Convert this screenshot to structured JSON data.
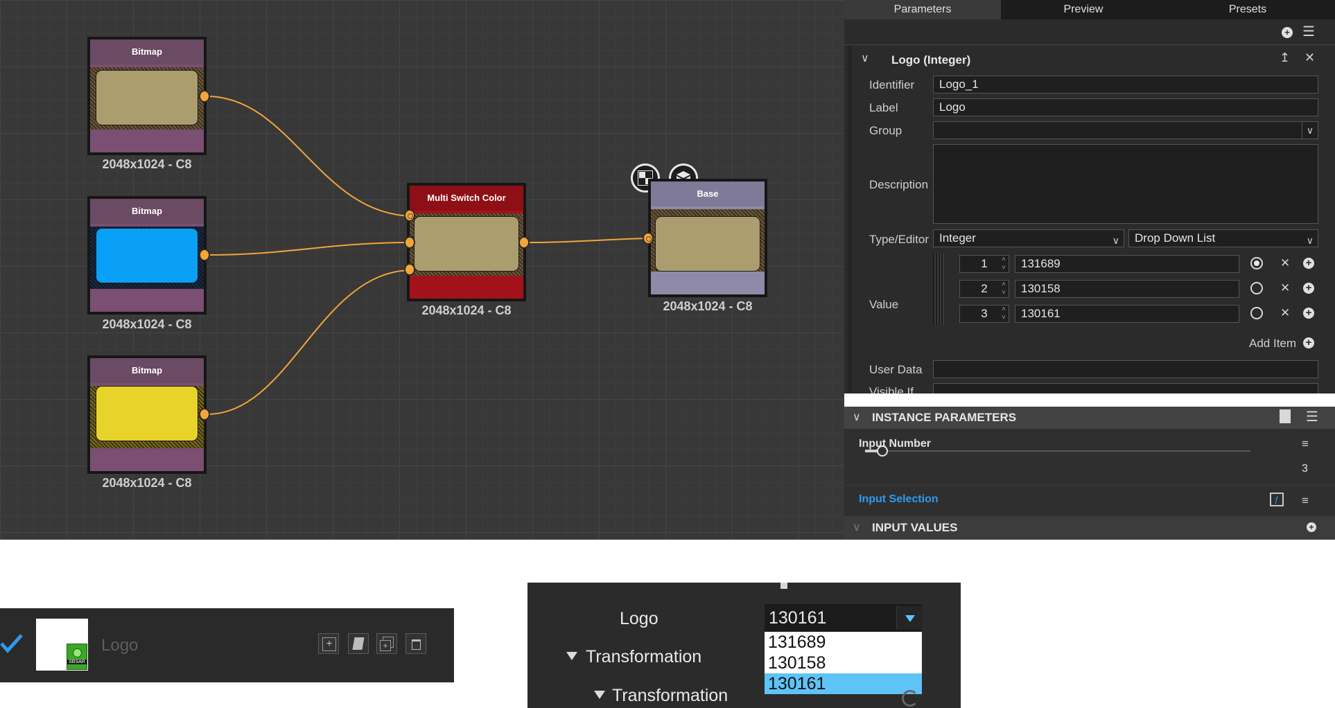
{
  "graph": {
    "nodes": [
      {
        "id": "bitmap-1",
        "title": "Bitmap",
        "resolution": "2048x1024 - C8",
        "color": "#ab9d6e"
      },
      {
        "id": "bitmap-2",
        "title": "Bitmap",
        "resolution": "2048x1024 - C8",
        "color": "#0aa0f7"
      },
      {
        "id": "bitmap-3",
        "title": "Bitmap",
        "resolution": "2048x1024 - C8",
        "color": "#e8d32a"
      },
      {
        "id": "multi-switch",
        "title": "Multi Switch Color",
        "resolution": "2048x1024 - C8",
        "color": "#ab9d6e"
      },
      {
        "id": "base",
        "title": "Base",
        "resolution": "2048x1024 - C8",
        "color": "#ab9d6e"
      }
    ],
    "node_colors": {
      "bitmap_header": "#6b4a63",
      "bitmap_body": "#7a4f72",
      "switch": "#a3121a",
      "base": "#8e8aa8",
      "wire": "#f4a53a"
    }
  },
  "panel": {
    "tabs": [
      "Parameters",
      "Preview",
      "Presets"
    ],
    "active_tab": "Parameters",
    "section_title": "Logo (Integer)",
    "labels": {
      "identifier": "Identifier",
      "label": "Label",
      "group": "Group",
      "description": "Description",
      "type_editor": "Type/Editor",
      "value": "Value",
      "user_data": "User Data",
      "visible_if": "Visible If"
    },
    "identifier_value": "Logo_1",
    "label_value": "Logo",
    "group_value": "",
    "type_value": "Integer",
    "editor_value": "Drop Down List",
    "value_items": [
      {
        "index": "1",
        "value": "131689",
        "selected": true
      },
      {
        "index": "2",
        "value": "130158",
        "selected": false
      },
      {
        "index": "3",
        "value": "130161",
        "selected": false
      }
    ],
    "add_item_label": "Add Item"
  },
  "instance": {
    "title": "INSTANCE PARAMETERS",
    "input_number_label": "Input Number",
    "input_number_value": "3",
    "input_number_slider_fraction": 0.02,
    "input_selection_label": "Input Selection",
    "input_values_title": "INPUT VALUES",
    "accent": "#2f9bf0"
  },
  "strip": {
    "name": "Logo",
    "badge": "SBSAR",
    "check_color": "#2f9bf0"
  },
  "dropdown": {
    "param_label": "Logo",
    "current_value": "130161",
    "options": [
      "131689",
      "130158",
      "130161"
    ],
    "highlighted": "130161",
    "group_1": "Transformation",
    "group_2": "Transformation",
    "highlight_color": "#5fc3f7"
  }
}
